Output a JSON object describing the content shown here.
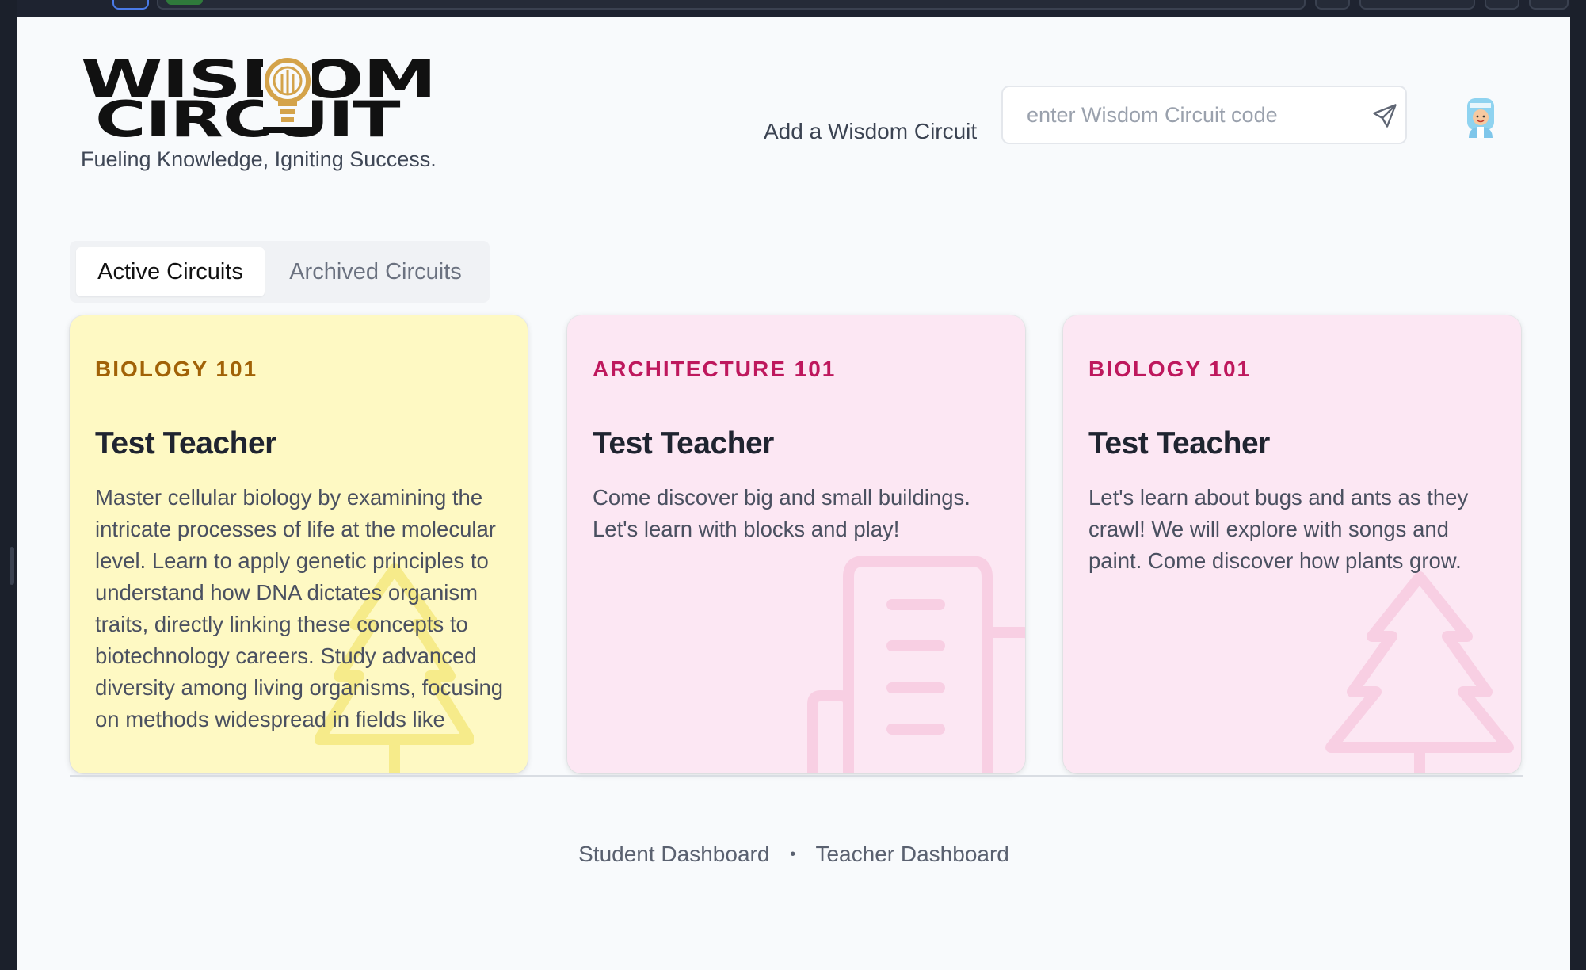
{
  "brand": {
    "logo_line1": "WISDOM",
    "logo_line2": "CIRCUIT",
    "tagline": "Fueling Knowledge, Igniting Success."
  },
  "header": {
    "add_label": "Add a Wisdom Circuit",
    "code_placeholder": "enter Wisdom Circuit code"
  },
  "tabs": [
    {
      "label": "Active Circuits"
    },
    {
      "label": "Archived Circuits"
    }
  ],
  "cards": [
    {
      "subject": "BIOLOGY 101",
      "teacher": "Test Teacher",
      "description": "Master cellular biology by examining the intricate processes of life at the molecular level. Learn to apply genetic principles to understand how DNA dictates organism traits, directly linking these concepts to biotechnology careers. Study advanced diversity among living organisms, focusing on methods widespread in fields like"
    },
    {
      "subject": "ARCHITECTURE 101",
      "teacher": "Test Teacher",
      "description": "Come discover big and small buildings. Let's learn with blocks and play!"
    },
    {
      "subject": "BIOLOGY 101",
      "teacher": "Test Teacher",
      "description": "Let's learn about bugs and ants as they crawl! We will explore with songs and paint. Come discover how plants grow."
    }
  ],
  "footer": {
    "links": [
      "Student Dashboard",
      "Teacher Dashboard"
    ],
    "separator": "•"
  },
  "colors": {
    "card_yellow": "#fef9c3",
    "card_pink": "#fce7f3",
    "subject_yellow": "#a16207",
    "subject_pink": "#be185d",
    "logo_accent": "#d4a34a"
  },
  "icons": {
    "send": "send-icon",
    "avatar": "user-avatar",
    "card1_bg": "tree-icon",
    "card2_bg": "building-icon",
    "card3_bg": "tree-icon",
    "logo_bulb": "lightbulb-icon"
  }
}
